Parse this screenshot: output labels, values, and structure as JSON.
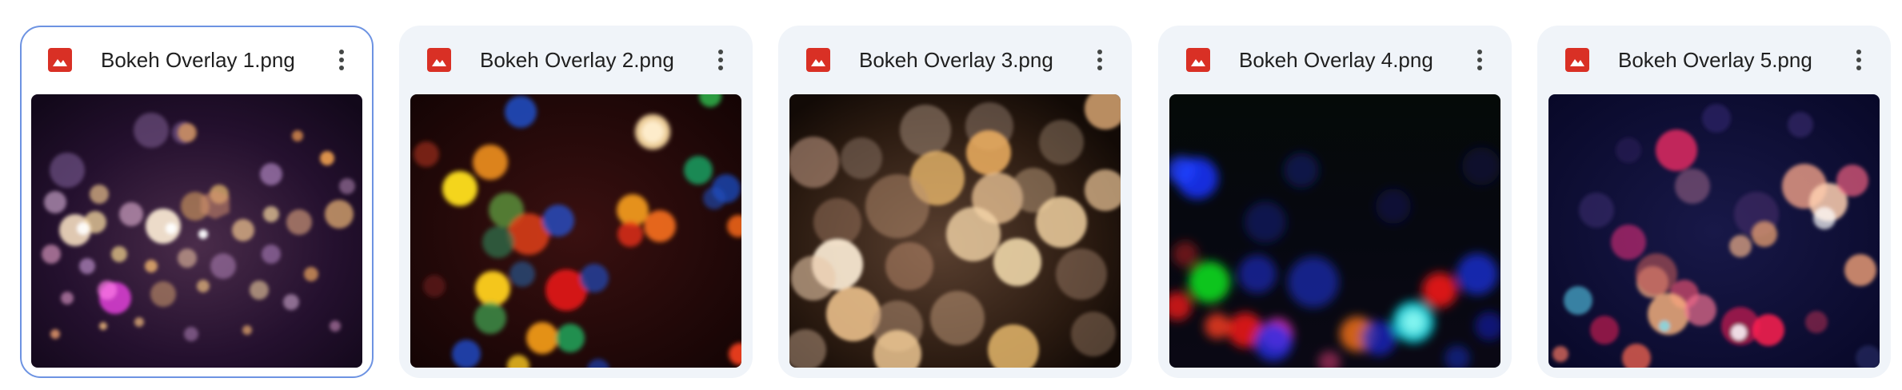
{
  "files": [
    {
      "name": "Bokeh Overlay 1.png",
      "selected": true,
      "icon": "image-file-icon"
    },
    {
      "name": "Bokeh Overlay 2.png",
      "selected": false,
      "icon": "image-file-icon"
    },
    {
      "name": "Bokeh Overlay 3.png",
      "selected": false,
      "icon": "image-file-icon"
    },
    {
      "name": "Bokeh Overlay 4.png",
      "selected": false,
      "icon": "image-file-icon"
    },
    {
      "name": "Bokeh Overlay 5.png",
      "selected": false,
      "icon": "image-file-icon"
    }
  ],
  "colors": {
    "file_icon": "#d93025",
    "selected_border": "#6d93e2",
    "card_background": "#f0f4f9"
  },
  "more_icon": "more-vert-icon"
}
